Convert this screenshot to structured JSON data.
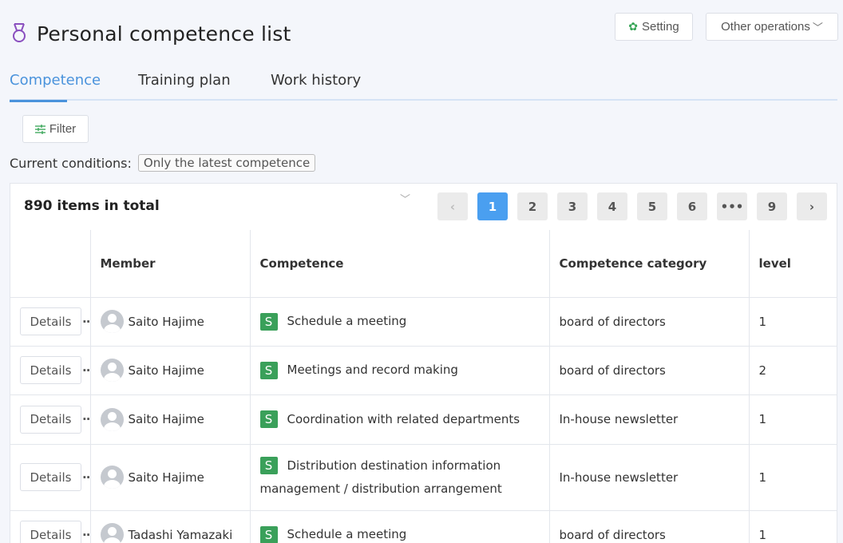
{
  "page_title": "Personal competence list",
  "buttons": {
    "setting": "Setting",
    "other_operations": "Other operations",
    "filter": "Filter",
    "details": "Details"
  },
  "tabs": [
    "Competence",
    "Training plan",
    "Work history"
  ],
  "conditions": {
    "label": "Current conditions:",
    "tag": "Only the latest competence"
  },
  "total": "890 items in total",
  "pagination": [
    "1",
    "2",
    "3",
    "4",
    "5",
    "6",
    "•••",
    "9"
  ],
  "columns": [
    "Member",
    "Competence",
    "Competence category",
    "level"
  ],
  "rows": [
    {
      "member": "Saito Hajime",
      "badge": "S",
      "competence": "Schedule a meeting",
      "category": "board of directors",
      "level": "1"
    },
    {
      "member": "Saito Hajime",
      "badge": "S",
      "competence": "Meetings and record making",
      "category": "board of directors",
      "level": "2"
    },
    {
      "member": "Saito Hajime",
      "badge": "S",
      "competence": "Coordination with related departments",
      "category": "In-house newsletter",
      "level": "1"
    },
    {
      "member": "Saito Hajime",
      "badge": "S",
      "competence": "Distribution destination information management / distribution arrangement",
      "category": "In-house newsletter",
      "level": "1"
    },
    {
      "member": "Tadashi Yamazaki",
      "badge": "S",
      "competence": "Schedule a meeting",
      "category": "board of directors",
      "level": "1"
    }
  ],
  "colors": {
    "accent": "#4a93dc",
    "badge": "#3aa05a",
    "active_page": "#4a9ff0",
    "medal_icon": "#8a4fbf"
  }
}
